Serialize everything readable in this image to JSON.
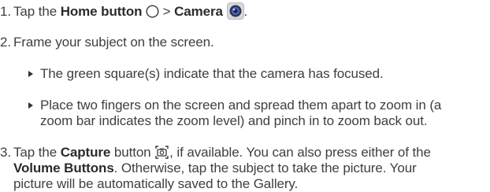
{
  "steps": {
    "s1": {
      "num": "1.",
      "pre": "Tap the ",
      "home": "Home button",
      "mid": " > ",
      "camera": "Camera",
      "end": "."
    },
    "s2": {
      "num": "2.",
      "text": "Frame your subject on the screen."
    },
    "bullets": {
      "b1": "The green square(s) indicate that the camera has focused.",
      "b2_l1": "Place two fingers on the screen and spread them apart to zoom in (a",
      "b2_l2": "zoom bar indicates the zoom level) and pinch in to zoom back out."
    },
    "s3": {
      "num": "3.",
      "pre": "Tap the ",
      "capture": "Capture",
      "mid": " button ",
      "post": ", if available. You can also press either of the",
      "volume": "Volume Buttons",
      "l2_rest": ". Otherwise, tap the subject to take the picture. Your",
      "l3": "picture will be automatically saved to the Gallery."
    }
  },
  "icons": {
    "home": "home-circle-icon",
    "camera": "camera-app-icon",
    "capture": "capture-shutter-icon"
  }
}
